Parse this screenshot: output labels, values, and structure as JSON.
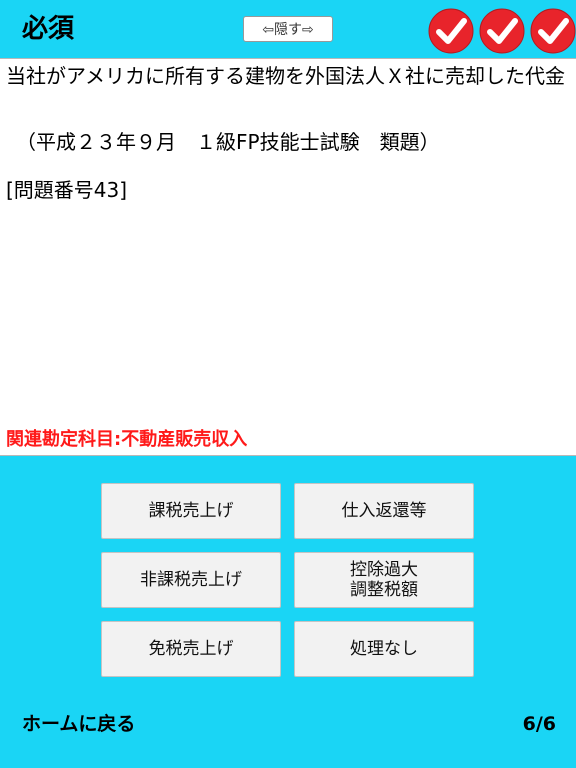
{
  "header": {
    "title": "必須",
    "hide_label": "⇦隠す⇨"
  },
  "check_marks": {
    "icon": "check-mark-icon",
    "count": 3,
    "color": "#e8242b"
  },
  "question": {
    "text": "当社がアメリカに所有する建物を外国法人Ｘ社に売却した代金",
    "source": "　（平成２３年９月　１級FP技能士試験　類題）",
    "number": "[問題番号43]",
    "related": "関連勘定科目:不動産販売収入"
  },
  "answers": [
    {
      "label": "課税売上げ"
    },
    {
      "label": "仕入返還等"
    },
    {
      "label": "非課税売上げ"
    },
    {
      "label": "控除過大\n調整税額"
    },
    {
      "label": "免税売上げ"
    },
    {
      "label": "処理なし"
    }
  ],
  "footer": {
    "home_label": "ホームに戻る",
    "page": "6/6"
  },
  "colors": {
    "background": "#1ad5f5",
    "related_text": "#ff1a1a"
  }
}
